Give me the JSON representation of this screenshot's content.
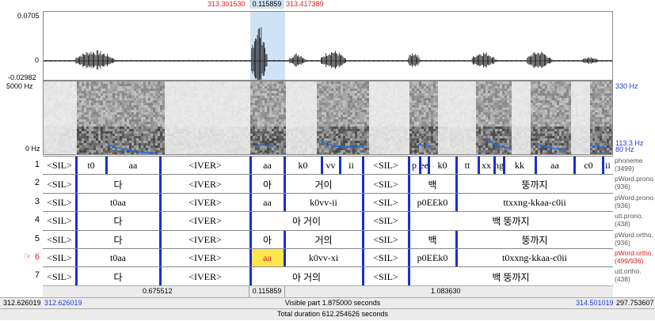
{
  "header": {
    "sel_start": "313.301530",
    "sel_dur": "0.115859",
    "sel_end": "313.417389"
  },
  "waveform": {
    "ymax": "0.0705",
    "yzero": "0",
    "ymin": "-0.02982"
  },
  "spectrogram": {
    "ymax": "5000 Hz",
    "ymin": "0 Hz",
    "right_top": "330 Hz",
    "right_mid": "113.3 Hz",
    "right_low": "80 Hz"
  },
  "tiers": [
    {
      "num": "1",
      "name": "phoneme",
      "count": "(3499)",
      "segs": [
        "<SIL>",
        "t0",
        "aa",
        "<IVER>",
        "aa",
        "k0",
        "vv",
        "ii",
        "<SIL>",
        "p",
        "ee",
        "k0",
        "tt",
        "xx",
        "ng",
        "kk",
        "aa",
        "c0",
        "ii"
      ]
    },
    {
      "num": "2",
      "name": "pWord.prono.",
      "count": "(936)",
      "segs": [
        "<SIL>",
        "다",
        "<IVER>",
        "아",
        "거이",
        "<SIL>",
        "백",
        "뚱까지"
      ]
    },
    {
      "num": "3",
      "name": "pWord.prono.",
      "count": "(936)",
      "segs": [
        "<SIL>",
        "t0aa",
        "<IVER>",
        "aa",
        "k0vv-ii",
        "<SIL>",
        "p0EEk0",
        "ttxxng-kkaa-c0ii"
      ]
    },
    {
      "num": "4",
      "name": "utt.prono.",
      "count": "(438)",
      "segs": [
        "<SIL>",
        "다",
        "<IVER>",
        "아 거이",
        "<SIL>",
        "백 뚱까지"
      ]
    },
    {
      "num": "5",
      "name": "pWord.ortho.",
      "count": "(936)",
      "segs": [
        "<SIL>",
        "다",
        "<IVER>",
        "아",
        "거의",
        "<SIL>",
        "백",
        "뚱까지"
      ]
    },
    {
      "num": "6",
      "name": "pWord.ortho.",
      "count": "(499/936)",
      "segs": [
        "<SIL>",
        "t0aa",
        "<IVER>",
        "aa",
        "k0vv-xi",
        "<SIL>",
        "p0EEk0",
        "t0xxng-kkaa-c0ii"
      ]
    },
    {
      "num": "7",
      "name": "utt.ortho.",
      "count": "(438)",
      "segs": [
        "<SIL>",
        "다",
        "<IVER>",
        "아 거의",
        "<SIL>",
        "백 뚱까지"
      ]
    }
  ],
  "active_tier_marker": "☞",
  "durations": {
    "left": "0.675512",
    "mid": "0.115859",
    "right": "1.083630"
  },
  "visible": {
    "left_outer": "312.626019",
    "left": "312.626019",
    "text": "Visible part 1.875000 seconds",
    "right": "314.501019",
    "right_outer": "297.753607"
  },
  "total": {
    "text": "Total duration 612.254626 seconds"
  },
  "colors": {
    "boundary": "#1a2fd6",
    "selection": "#cfe3f6",
    "highlight": "#ffe64d",
    "pitch": "#1f6fe0"
  }
}
